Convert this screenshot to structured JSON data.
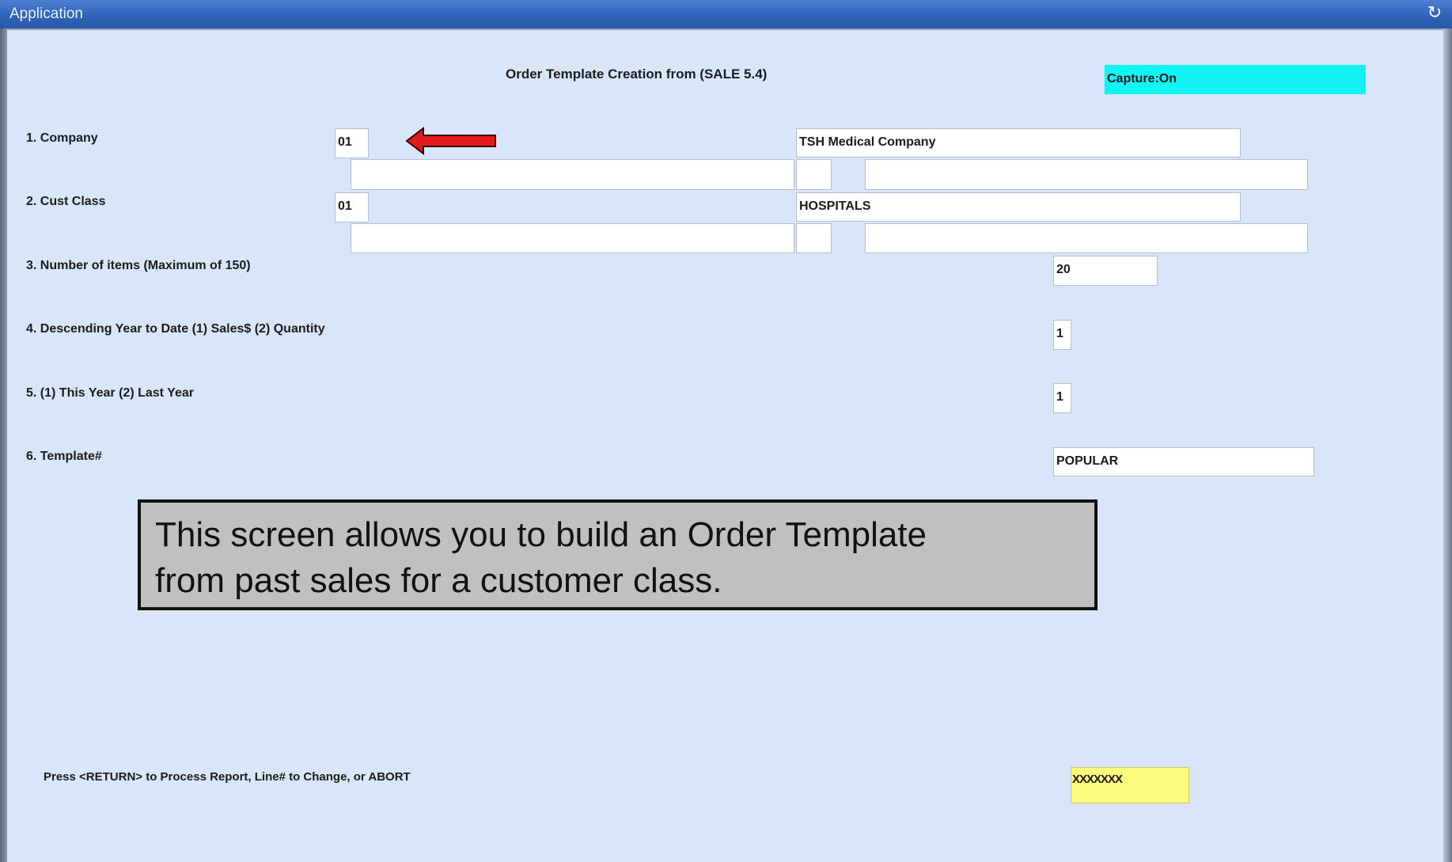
{
  "window": {
    "title": "Application",
    "title_icon": "refresh-icon"
  },
  "screen": {
    "title": "Order Template Creation from (SALE 5.4)",
    "capture_status": "Capture:On"
  },
  "fields": {
    "company": {
      "label": "1. Company",
      "value": "01",
      "description": "TSH Medical Company"
    },
    "cust_class": {
      "label": "2. Cust Class",
      "value": "01",
      "description": "HOSPITALS"
    },
    "num_items": {
      "label": "3. Number of items (Maximum of 150)",
      "value": "20"
    },
    "descending": {
      "label": "4. Descending Year to Date (1) Sales$ (2) Quantity",
      "value": "1"
    },
    "year": {
      "label": "5. (1) This Year  (2) Last Year",
      "value": "1"
    },
    "template": {
      "label": "6. Template#",
      "value": "POPULAR"
    }
  },
  "callout": {
    "line1": "This screen allows you to build an Order Template",
    "line2": "from past sales for a customer class."
  },
  "prompt": {
    "text": "Press <RETURN> to Process Report, Line# to Change, or ABORT",
    "response": "XXXXXXX"
  },
  "colors": {
    "background": "#d9e6f9",
    "capture_highlight": "#12f4f4",
    "response_highlight": "#fbfc7d",
    "arrow": "#e31a1a",
    "titlebar": "#2f64bb",
    "callout": "#c0c0c0"
  }
}
